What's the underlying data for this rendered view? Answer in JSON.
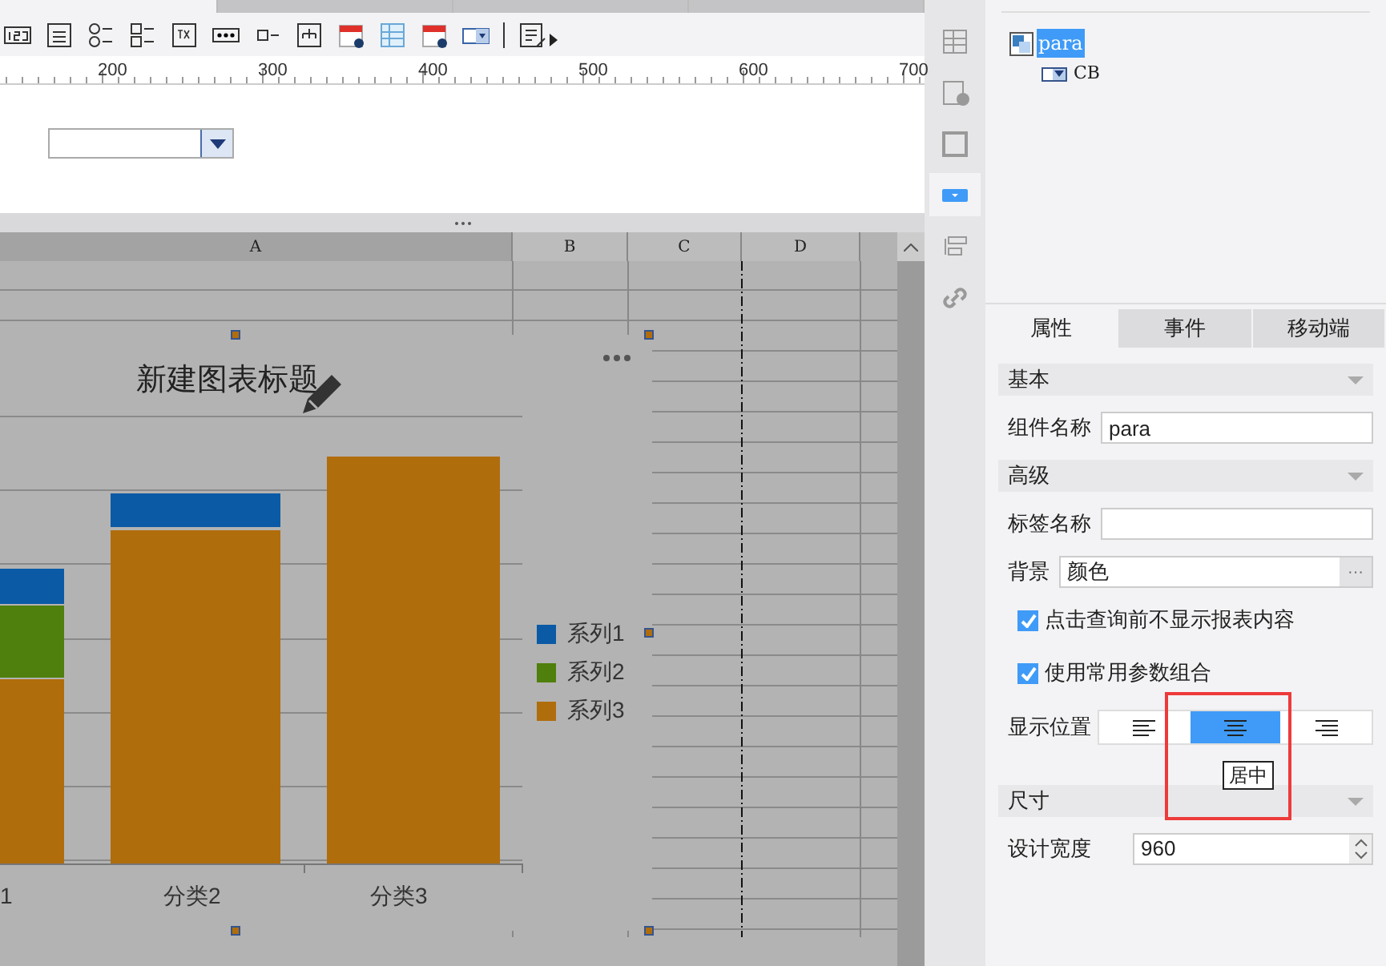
{
  "document_tabs": [
    {
      "selected": true
    },
    {
      "selected": false
    },
    {
      "selected": false
    },
    {
      "selected": false
    }
  ],
  "ruler": {
    "labels": [
      "200",
      "300",
      "400",
      "500",
      "600",
      "700"
    ]
  },
  "sheet": {
    "columns": [
      "A",
      "B",
      "C",
      "D"
    ]
  },
  "chart": {
    "title": "新建图表标题",
    "categories": [
      "1",
      "分类2",
      "分类3"
    ],
    "legend": [
      {
        "label": "系列1",
        "color": "#0b5aa6"
      },
      {
        "label": "系列2",
        "color": "#4f7f0c"
      },
      {
        "label": "系列3",
        "color": "#b06d0c"
      }
    ]
  },
  "sidebar_tools": [
    {
      "selected": false
    },
    {
      "selected": false
    },
    {
      "selected": false
    },
    {
      "selected": true
    },
    {
      "selected": false
    },
    {
      "selected": false
    }
  ],
  "tree": {
    "items": [
      {
        "label": "para",
        "selected": true,
        "children": [
          {
            "label": "CB",
            "selected": false
          }
        ]
      }
    ]
  },
  "property_tabs": [
    {
      "label": "属性",
      "selected": true
    },
    {
      "label": "事件",
      "selected": false
    },
    {
      "label": "移动端",
      "selected": false
    }
  ],
  "rows": [
    {
      "kind": "section",
      "label": "基本"
    },
    {
      "kind": "text",
      "label": "组件名称",
      "value": "para"
    },
    {
      "kind": "section",
      "label": "高级"
    },
    {
      "kind": "text",
      "label": "标签名称",
      "value": ""
    },
    {
      "kind": "picker",
      "label": "背景",
      "value": "颜色",
      "button": "···"
    },
    {
      "kind": "checkbox",
      "label": "点击查询前不显示报表内容",
      "checked": true
    },
    {
      "kind": "checkbox",
      "label": "使用常用参数组合",
      "checked": true
    },
    {
      "kind": "align",
      "label": "显示位置",
      "options": [
        {
          "selected": false
        },
        {
          "selected": true
        },
        {
          "selected": false
        }
      ],
      "tooltip": "居中"
    },
    {
      "kind": "section",
      "label": "尺寸"
    },
    {
      "kind": "number",
      "label": "设计宽度",
      "value": "960"
    }
  ]
}
